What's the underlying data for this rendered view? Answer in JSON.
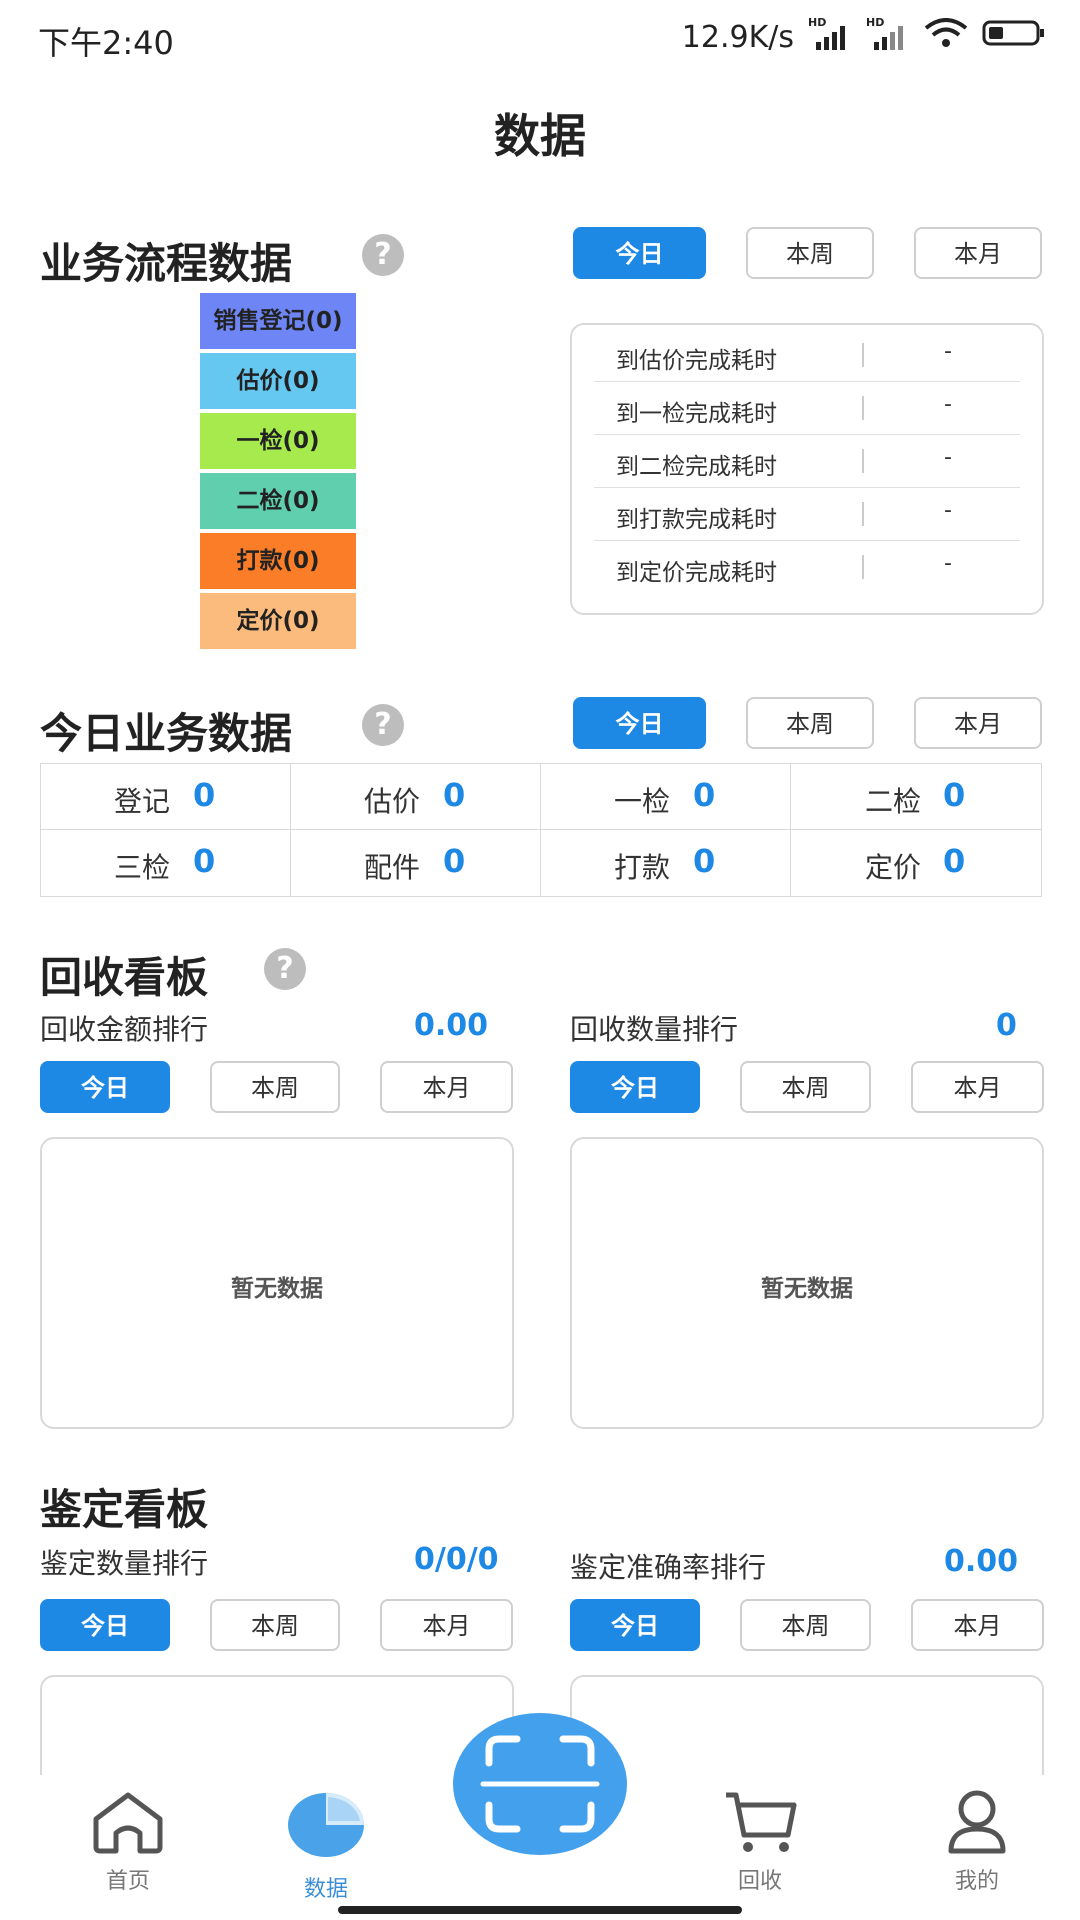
{
  "status_bar": {
    "time": "下午2:40",
    "network_speed": "12.9K/s",
    "signal_label_1": "HD",
    "signal_label_2": "HD"
  },
  "page_title": "数据",
  "period_buttons": {
    "today": "今日",
    "week": "本周",
    "month": "本月"
  },
  "process_section": {
    "title": "业务流程数据",
    "help": "?",
    "funnel": [
      {
        "label": "销售登记(0)",
        "color": "#6e86f5"
      },
      {
        "label": "估价(0)",
        "color": "#64c8f0"
      },
      {
        "label": "一检(0)",
        "color": "#a6ea4d"
      },
      {
        "label": "二检(0)",
        "color": "#5fcfae"
      },
      {
        "label": "打款(0)",
        "color": "#fb7d27"
      },
      {
        "label": "定价(0)",
        "color": "#fbbb7c"
      }
    ],
    "times": [
      {
        "label": "到估价完成耗时",
        "value": "-"
      },
      {
        "label": "到一检完成耗时",
        "value": "-"
      },
      {
        "label": "到二检完成耗时",
        "value": "-"
      },
      {
        "label": "到打款完成耗时",
        "value": "-"
      },
      {
        "label": "到定价完成耗时",
        "value": "-"
      }
    ]
  },
  "today_section": {
    "title": "今日业务数据",
    "help": "?",
    "stats": [
      {
        "label": "登记",
        "value": "0"
      },
      {
        "label": "估价",
        "value": "0"
      },
      {
        "label": "一检",
        "value": "0"
      },
      {
        "label": "二检",
        "value": "0"
      },
      {
        "label": "三检",
        "value": "0"
      },
      {
        "label": "配件",
        "value": "0"
      },
      {
        "label": "打款",
        "value": "0"
      },
      {
        "label": "定价",
        "value": "0"
      }
    ]
  },
  "recycle_section": {
    "title": "回收看板",
    "help": "?",
    "left": {
      "label": "回收金额排行",
      "value": "0.00",
      "empty": "暂无数据"
    },
    "right": {
      "label": "回收数量排行",
      "value": "0",
      "empty": "暂无数据"
    }
  },
  "appraisal_section": {
    "title": "鉴定看板",
    "left": {
      "label": "鉴定数量排行",
      "value": "0/0/0"
    },
    "right": {
      "label": "鉴定准确率排行",
      "value": "0.00"
    }
  },
  "bottom_nav": {
    "home": "首页",
    "data": "数据",
    "recycle": "回收",
    "mine": "我的"
  },
  "colors": {
    "accent": "#1e88e5",
    "active_nav": "#3b8fd8"
  }
}
